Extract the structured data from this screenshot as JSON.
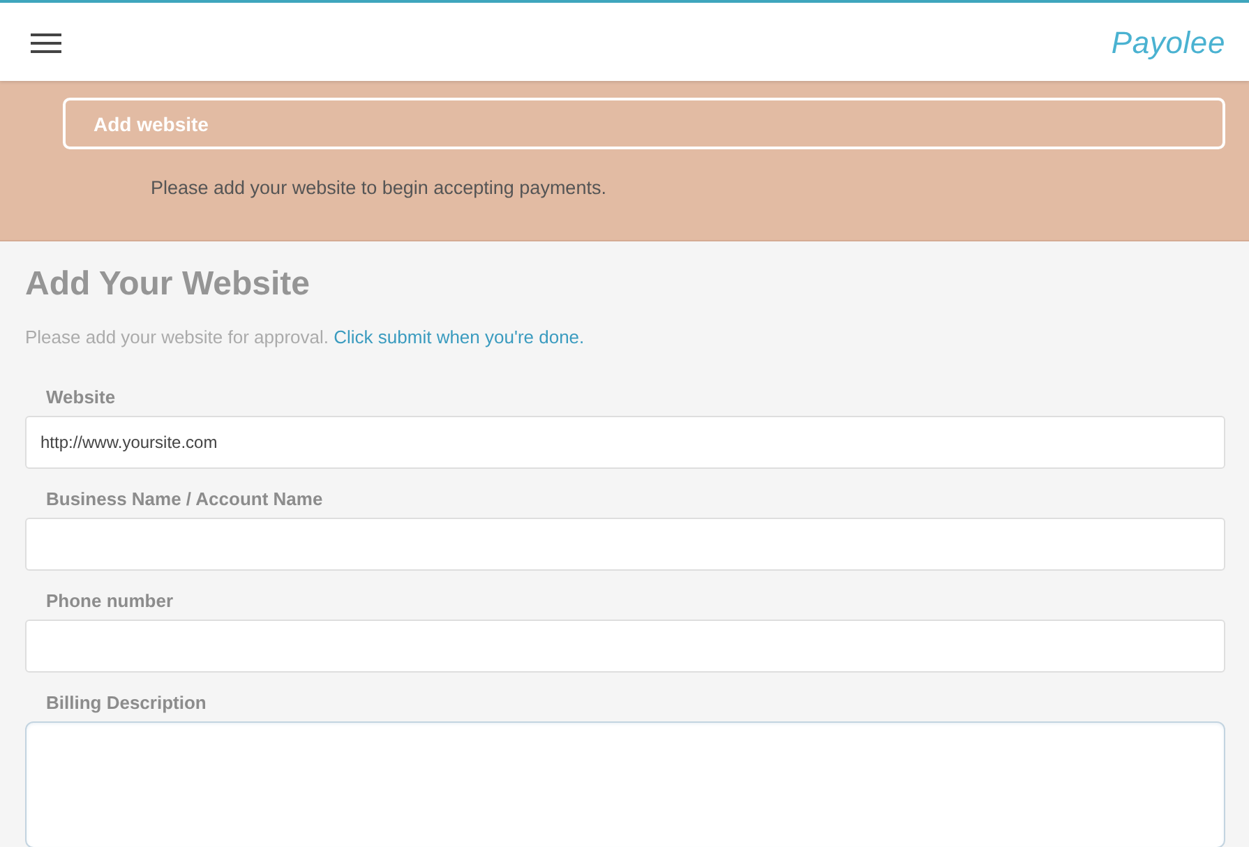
{
  "header": {
    "logo": "Payolee"
  },
  "banner": {
    "button": "Add website",
    "message": "Please add your website to begin accepting payments."
  },
  "form": {
    "title": "Add Your Website",
    "intro": "Please add your website for approval.",
    "intro_link": "Click submit when you're done.",
    "fields": [
      {
        "kind": "input",
        "label": "Website",
        "value": "http://www.yoursite.com",
        "focused": false
      },
      {
        "kind": "input",
        "label": "Business Name / Account Name",
        "focused": false
      },
      {
        "kind": "input",
        "label": "Phone number",
        "focused": false
      },
      {
        "kind": "textarea",
        "label": "Billing Description",
        "focused": true
      }
    ]
  }
}
